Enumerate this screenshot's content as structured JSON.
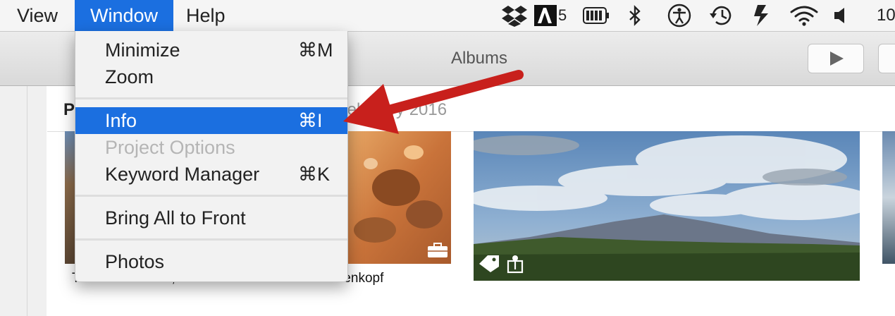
{
  "menubar": {
    "view": "View",
    "window": "Window",
    "help": "Help",
    "clock": "10",
    "battery_icon": "battery-icon",
    "adobe_suffix": "5"
  },
  "toolbar": {
    "title": "Albums"
  },
  "content": {
    "header_partial": "P",
    "date_partial": "February 2016",
    "captions": [
      "The three sisters, Blue...",
      "Totenkopf"
    ]
  },
  "window_menu": {
    "items": [
      {
        "label": "Minimize",
        "shortcut": "⌘M",
        "state": "normal"
      },
      {
        "label": "Zoom",
        "shortcut": "",
        "state": "normal"
      },
      {
        "label": "Info",
        "shortcut": "⌘I",
        "state": "highlighted"
      },
      {
        "label": "Project Options",
        "shortcut": "",
        "state": "disabled"
      },
      {
        "label": "Keyword Manager",
        "shortcut": "⌘K",
        "state": "normal"
      },
      {
        "label": "Bring All to Front",
        "shortcut": "",
        "state": "normal"
      },
      {
        "label": "Photos",
        "shortcut": "",
        "state": "normal"
      }
    ]
  },
  "colors": {
    "menu_highlight": "#1b6fe0",
    "arrow": "#c8201c"
  }
}
